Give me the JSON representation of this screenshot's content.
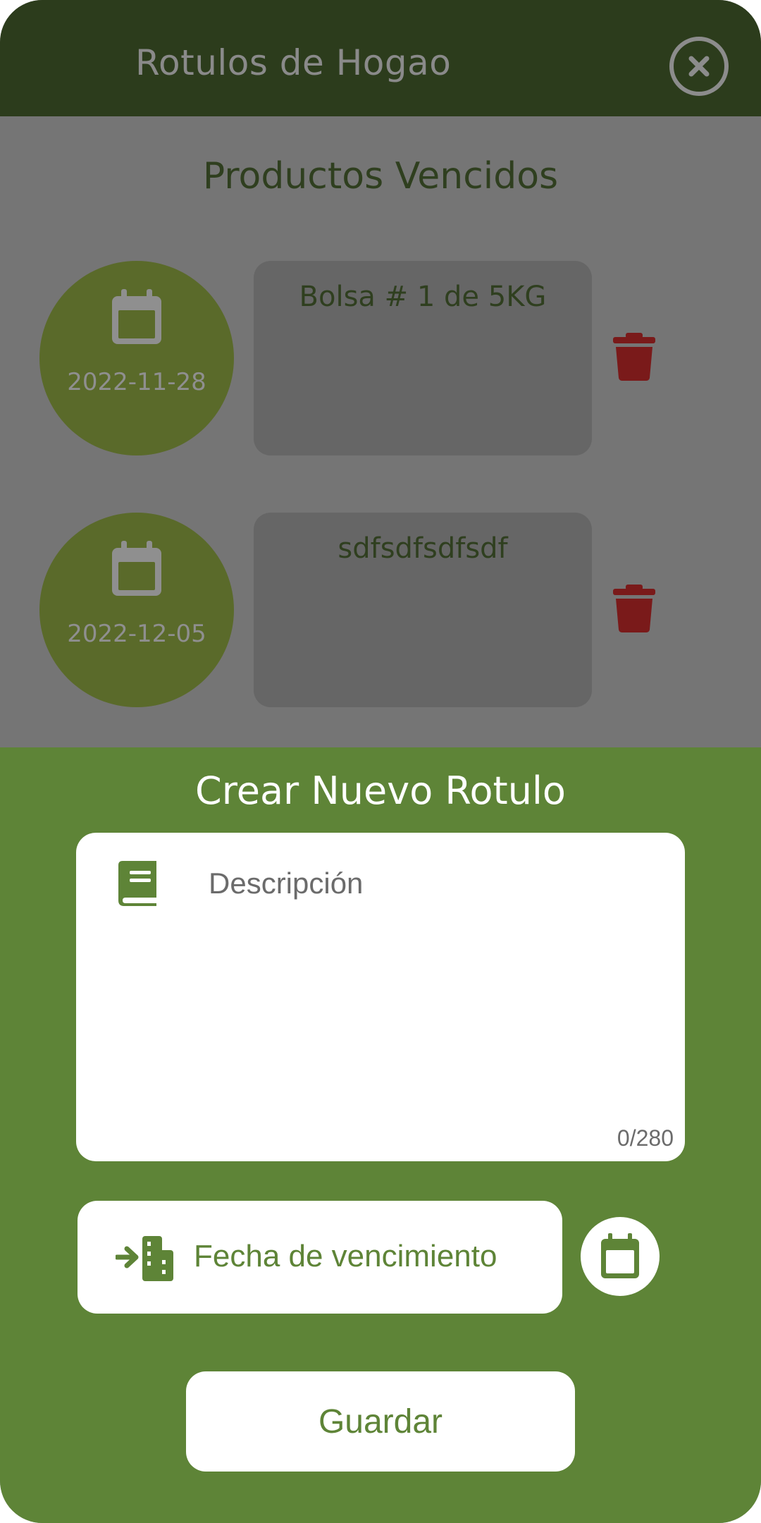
{
  "header": {
    "title": "Rotulos de Hogao",
    "close_icon": "close-circle-icon"
  },
  "expired": {
    "title": "Productos Vencidos",
    "items": [
      {
        "date": "2022-11-28",
        "description": "Bolsa # 1 de 5KG"
      },
      {
        "date": "2022-12-05",
        "description": "sdfsdfsdfsdf"
      }
    ]
  },
  "create": {
    "title": "Crear Nuevo Rotulo",
    "description_placeholder": "Descripción",
    "description_value": "",
    "counter": "0/280",
    "date_label": "Fecha de vencimiento",
    "save_label": "Guardar"
  },
  "colors": {
    "header_bg": "#2c3c1c",
    "overlay_bg": "#757575",
    "panel_bg": "#5e8437",
    "circle_bg": "#5a6a2a",
    "trash": "#7a1a1a"
  }
}
